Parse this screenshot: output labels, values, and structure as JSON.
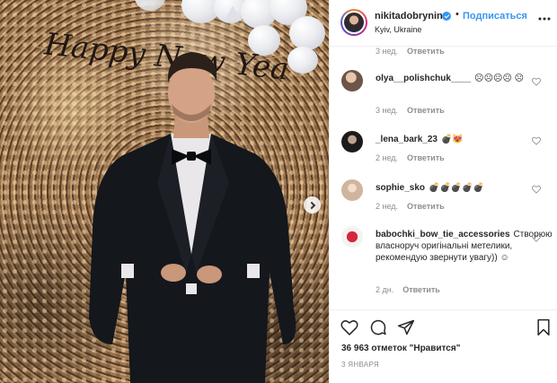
{
  "post": {
    "banner_text": "Happy New Year!"
  },
  "header": {
    "username": "nikitadobrynin",
    "separator": "•",
    "follow_label": "Подписаться",
    "location": "Kyiv, Ukraine",
    "more_icon": "ellipsis-icon"
  },
  "comments": {
    "top_meta": {
      "time": "3 нед.",
      "reply_label": "Ответить"
    },
    "items": [
      {
        "username": "olya__polishchuk____",
        "text": "☹☹☹☹ ☹",
        "time": "3 нед.",
        "reply_label": "Ответить",
        "avatar_color": "#7a6a5e"
      },
      {
        "username": "_lena_bark_23",
        "text": "💣😻",
        "time": "2 нед.",
        "reply_label": "Ответить",
        "avatar_color": "#2f2a28"
      },
      {
        "username": "sophie_sko",
        "text": "💣💣💣💣💣",
        "time": "2 нед.",
        "reply_label": "Ответить",
        "avatar_color": "#e9d8c8"
      },
      {
        "username": "babochki_bow_tie_accessories",
        "text": "Створюю власноруч оригінальні метелики, рекомендую звернути увагу)) ☺",
        "time": "2 дн.",
        "reply_label": "Ответить",
        "avatar_color": "#c0202c"
      }
    ]
  },
  "actions": {
    "likes_text": "36 963 отметок \"Нравится\"",
    "date": "3 ЯНВАРЯ",
    "icons": [
      "heart-icon",
      "comment-icon",
      "share-icon",
      "bookmark-icon"
    ]
  },
  "colors": {
    "accent": "#3897f0",
    "text": "#262626",
    "muted": "#8e8e8e",
    "border": "#efefef"
  }
}
